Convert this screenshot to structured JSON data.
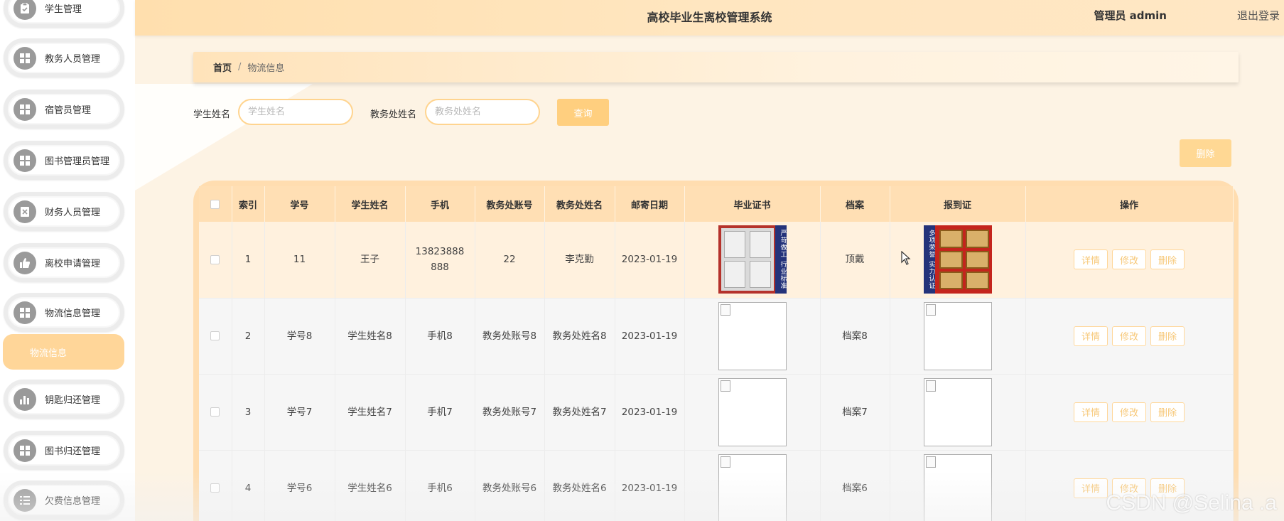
{
  "header": {
    "title": "高校毕业生离校管理系统",
    "user": "管理员 admin",
    "logout": "退出登录"
  },
  "sidebar": {
    "items": [
      {
        "label": "学生管理",
        "icon": "clipboard-icon"
      },
      {
        "label": "教务人员管理",
        "icon": "grid-icon"
      },
      {
        "label": "宿管员管理",
        "icon": "grid-icon"
      },
      {
        "label": "图书管理员管理",
        "icon": "grid-icon"
      },
      {
        "label": "财务人员管理",
        "icon": "document-x-icon"
      },
      {
        "label": "离校申请管理",
        "icon": "thumb-up-icon"
      },
      {
        "label": "物流信息管理",
        "icon": "grid-icon"
      },
      {
        "label": "钥匙归还管理",
        "icon": "bar-chart-icon"
      },
      {
        "label": "图书归还管理",
        "icon": "grid-icon"
      },
      {
        "label": "欠费信息管理",
        "icon": "list-icon"
      }
    ],
    "active_sub": "物流信息"
  },
  "breadcrumb": {
    "home": "首页",
    "separator": "/",
    "current": "物流信息"
  },
  "search": {
    "student_name_label": "学生姓名",
    "student_name_placeholder": "学生姓名",
    "office_name_label": "教务处姓名",
    "office_name_placeholder": "教务处姓名",
    "query_button": "查询"
  },
  "toolbar": {
    "delete_button": "删除"
  },
  "table": {
    "columns": [
      "索引",
      "学号",
      "学生姓名",
      "手机",
      "教务处账号",
      "教务处姓名",
      "邮寄日期",
      "毕业证书",
      "档案",
      "报到证",
      "操作"
    ],
    "rows": [
      {
        "index": "1",
        "student_no": "11",
        "student_name": "王子",
        "phone": "13823888888",
        "office_account": "22",
        "office_name": "李克勤",
        "mail_date": "2023-01-19",
        "archive": "顶戴"
      },
      {
        "index": "2",
        "student_no": "学号8",
        "student_name": "学生姓名8",
        "phone": "手机8",
        "office_account": "教务处账号8",
        "office_name": "教务处姓名8",
        "mail_date": "2023-01-19",
        "archive": "档案8"
      },
      {
        "index": "3",
        "student_no": "学号7",
        "student_name": "学生姓名7",
        "phone": "手机7",
        "office_account": "教务处账号7",
        "office_name": "教务处姓名7",
        "mail_date": "2023-01-19",
        "archive": "档案7"
      },
      {
        "index": "4",
        "student_no": "学号6",
        "student_name": "学生姓名6",
        "phone": "手机6",
        "office_account": "教务处账号6",
        "office_name": "教务处姓名6",
        "mail_date": "2023-01-19",
        "archive": "档案6"
      }
    ],
    "cert_image_text": "严苛做工 行业标准",
    "report_image_text": "多项荣誉 实力认证",
    "actions": {
      "detail": "详情",
      "edit": "修改",
      "delete": "删除"
    }
  },
  "watermark": "CSDN @Selina .a",
  "colors": {
    "accent": "#ffcf7f",
    "header": "#ffdfae",
    "table_header": "#ffdfb4",
    "active_nav": "#ffd699"
  }
}
